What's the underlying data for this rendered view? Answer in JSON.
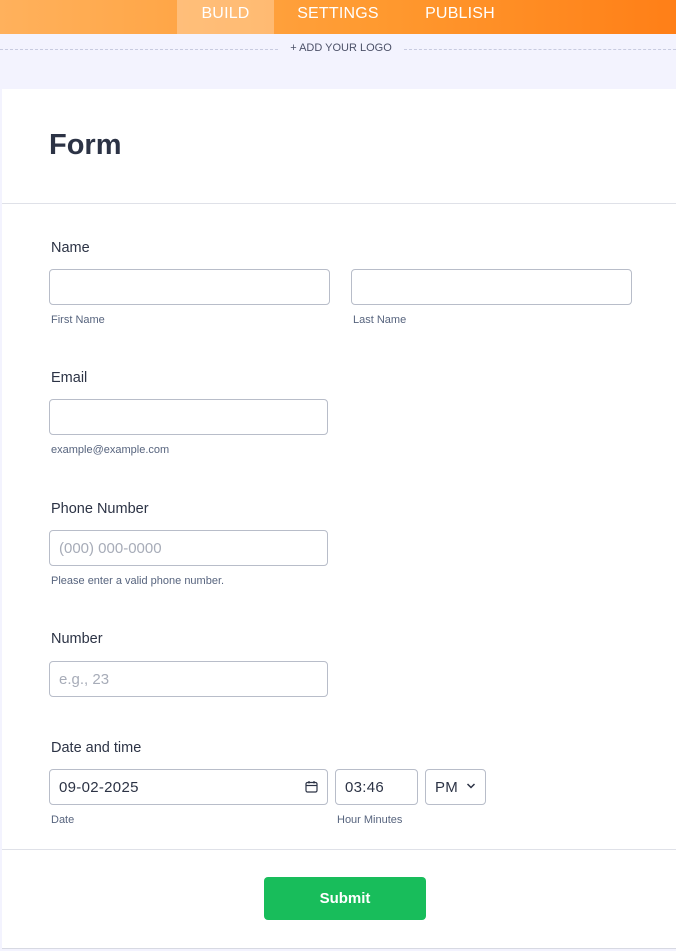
{
  "tabs": {
    "build": "BUILD",
    "settings": "SETTINGS",
    "publish": "PUBLISH"
  },
  "logo": {
    "label": "+ ADD YOUR LOGO"
  },
  "form": {
    "title": "Form",
    "name": {
      "label": "Name",
      "first_value": "",
      "first_sublabel": "First Name",
      "last_value": "",
      "last_sublabel": "Last Name"
    },
    "email": {
      "label": "Email",
      "value": "",
      "sublabel": "example@example.com"
    },
    "phone": {
      "label": "Phone Number",
      "placeholder": "(000) 000-0000",
      "value": "",
      "sublabel": "Please enter a valid phone number."
    },
    "number": {
      "label": "Number",
      "placeholder": "e.g., 23",
      "value": ""
    },
    "datetime": {
      "label": "Date and time",
      "date_value": "09-02-2025",
      "date_sublabel": "Date",
      "time_value": "03:46",
      "time_sublabel": "Hour Minutes",
      "ampm_value": "PM"
    },
    "submit_label": "Submit"
  },
  "icons": {
    "date_picker": "calendar-icon",
    "ampm_dropdown": "chevron-down-icon"
  },
  "colors": {
    "header_start": "#ffb15c",
    "header_end": "#ff7f17",
    "submit": "#18bd5b",
    "page_bg": "#f3f3fe"
  }
}
